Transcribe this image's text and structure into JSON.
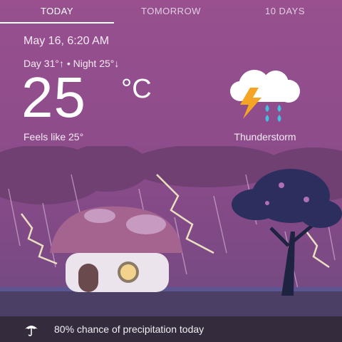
{
  "tabs": [
    {
      "label": "TODAY",
      "active": true
    },
    {
      "label": "TOMORROW",
      "active": false
    },
    {
      "label": "10 DAYS",
      "active": false
    }
  ],
  "weather": {
    "date_time": "May 16, 6:20 AM",
    "day_night": "Day 31°↑ • Night 25°↓",
    "temperature": "25",
    "unit": "°C",
    "feels_like": "Feels like 25°",
    "condition": "Thunderstorm",
    "condition_icon": "thunderstorm-icon"
  },
  "precipitation": {
    "text": "80% chance of precipitation today",
    "icon": "umbrella-icon"
  },
  "colors": {
    "background": "#8e4c8b",
    "bar": "#342c3d",
    "lightning": "#f5a524",
    "rain": "#3fc3e0"
  }
}
